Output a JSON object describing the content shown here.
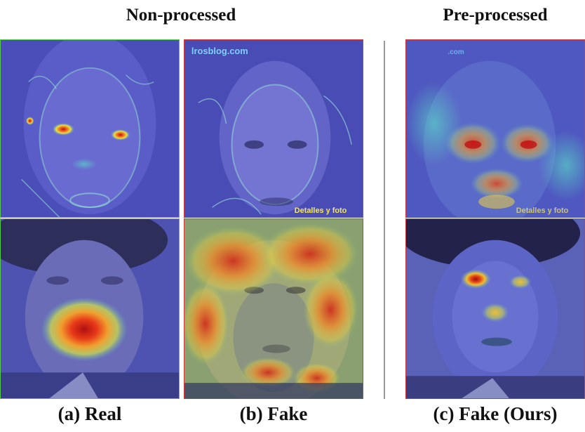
{
  "headings": {
    "left": "Non-processed",
    "right": "Pre-processed"
  },
  "captions": {
    "a": "(a) Real",
    "b": "(b) Fake",
    "c": "(c) Fake (Ours)"
  },
  "watermarks": {
    "site": "lrosblog.com",
    "brand": "Detalles y foto"
  },
  "colors": {
    "real_border": "#55c94a",
    "fake_border": "#d23a3a",
    "heatmap_low": "#4a4fc8",
    "heatmap_high": "#e02a10"
  }
}
